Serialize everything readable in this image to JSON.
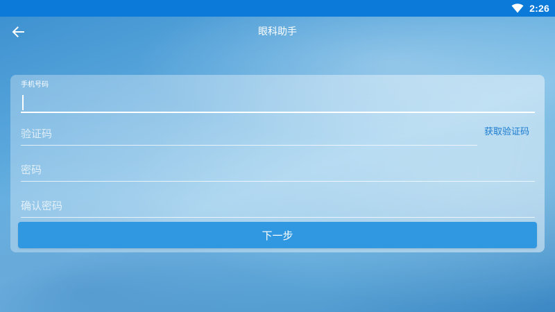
{
  "status_bar": {
    "time": "2:26",
    "wifi_icon": "wifi-icon"
  },
  "app_bar": {
    "title": "眼科助手",
    "back_icon": "arrow-left-icon"
  },
  "form": {
    "phone": {
      "label": "手机号码",
      "value": ""
    },
    "verification_code": {
      "placeholder": "验证码",
      "get_code_label": "获取验证码"
    },
    "password": {
      "placeholder": "密码"
    },
    "confirm_password": {
      "placeholder": "确认密码"
    },
    "next_label": "下一步"
  },
  "colors": {
    "status_bar": "#0b7ad9",
    "accent": "#3098e0",
    "link": "#1a7bd0"
  }
}
